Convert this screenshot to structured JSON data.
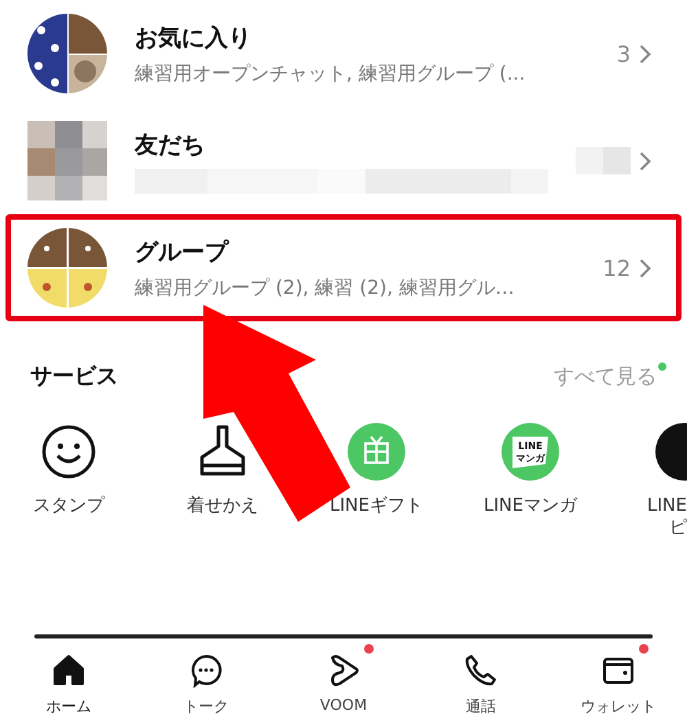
{
  "rows": [
    {
      "kind": "favorites",
      "title": "お気に入り",
      "subtitle": "練習用オープンチャット, 練習用グループ (...",
      "count": "3",
      "highlighted": false
    },
    {
      "kind": "friends",
      "title": "友だち",
      "highlighted": false
    },
    {
      "kind": "groups",
      "title": "グループ",
      "subtitle": "練習用グループ (2), 練習 (2), 練習用グル…",
      "count": "12",
      "highlighted": true
    }
  ],
  "annotation_arrow": true,
  "services": {
    "title": "サービス",
    "see_all": "すべて見る",
    "see_all_new": true,
    "items": [
      {
        "kind": "sticker",
        "label": "スタンプ"
      },
      {
        "kind": "theme",
        "label": "着せかえ"
      },
      {
        "kind": "gift",
        "label": "LINEギフト"
      },
      {
        "kind": "manga",
        "label": "LINEマンガ",
        "icon_text": [
          "LINE",
          "マンガ"
        ]
      },
      {
        "kind": "shopping",
        "label_lines": [
          "LINE",
          "ピ"
        ]
      }
    ]
  },
  "nav": [
    {
      "kind": "home",
      "label": "ホーム",
      "selected": true,
      "badge": false
    },
    {
      "kind": "talk",
      "label": "トーク",
      "selected": false,
      "badge": false
    },
    {
      "kind": "voom",
      "label": "VOOM",
      "selected": false,
      "badge": true
    },
    {
      "kind": "call",
      "label": "通話",
      "selected": false,
      "badge": false
    },
    {
      "kind": "wallet",
      "label": "ウォレット",
      "selected": false,
      "badge": true
    }
  ]
}
